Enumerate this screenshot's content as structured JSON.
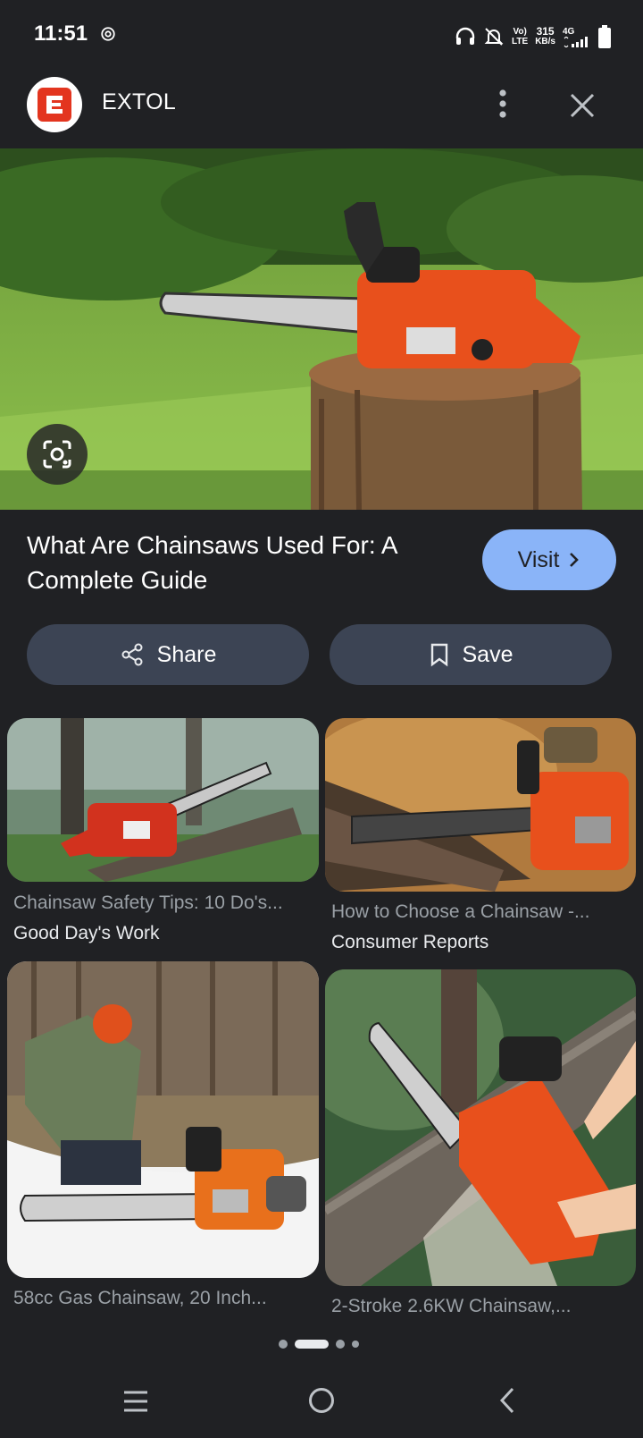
{
  "status_bar": {
    "time": "11:51",
    "network_top": "Vo)",
    "network_bottom": "LTE",
    "speed_value": "315",
    "speed_unit": "KB/s",
    "signal_label": "4G"
  },
  "header": {
    "logo_letter": "E",
    "title": "EXTOL"
  },
  "result": {
    "title": "What Are Chainsaws Used For: A Complete Guide",
    "visit_label": "Visit",
    "share_label": "Share",
    "save_label": "Save"
  },
  "related": [
    {
      "title": "Chainsaw Safety Tips: 10 Do's...",
      "source": "Good Day's Work"
    },
    {
      "title": "How to Choose a Chainsaw -...",
      "source": "Consumer Reports"
    },
    {
      "title": "58cc Gas Chainsaw, 20 Inch...",
      "source": ""
    },
    {
      "title": "2-Stroke 2.6KW Chainsaw,...",
      "source": ""
    }
  ],
  "colors": {
    "background": "#202124",
    "accent": "#8ab4f8",
    "pill": "#3c4454",
    "chainsaw_orange": "#e8501c",
    "logo_red": "#e3351f"
  },
  "icons": [
    "threads-icon",
    "headphones-icon",
    "bell-off-icon",
    "battery-icon",
    "more-vert-icon",
    "close-icon",
    "lens-icon",
    "chevron-right-icon",
    "share-icon",
    "bookmark-icon",
    "menu-icon",
    "home-icon",
    "back-icon"
  ]
}
